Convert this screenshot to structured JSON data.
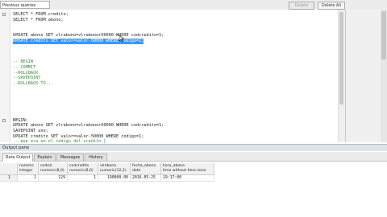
{
  "history": {
    "previous_queries": "Previous queries",
    "delete_label": "Delete",
    "delete_all_label": "Delete All"
  },
  "editor": {
    "lines": [
      {
        "t": "SELECT * FROM credito;"
      },
      {
        "t": "SELECT * FROM abono;"
      },
      {
        "t": ""
      },
      {
        "t": ""
      },
      {
        "t": "UPDATE abono SET vlrabono=vlrabono+50000 WHERE codcredito=1;"
      },
      {
        "t": "UPDATE credito SET valor=valor-50000 WHERE codigo=1;",
        "sel": true
      },
      {
        "t": ""
      },
      {
        "t": ""
      },
      {
        "t": ""
      },
      {
        "t": "-- BEGIN",
        "cm": true
      },
      {
        "t": "-- COMMIT",
        "cm": true
      },
      {
        "t": "--ROLLBACK",
        "cm": true
      },
      {
        "t": "--SAVEPOINT",
        "cm": true
      },
      {
        "t": "--ROLLBACK TO...",
        "cm": true
      },
      {
        "t": ""
      },
      {
        "t": ""
      },
      {
        "t": ""
      },
      {
        "t": ""
      },
      {
        "t": ""
      },
      {
        "t": ""
      },
      {
        "t": "BEGIN;"
      },
      {
        "t": "UPDATE abono SET vlrabono=vlrabono+50000 WHERE codcredito=1;"
      },
      {
        "t": "SAVEPOINT uno;"
      },
      {
        "t": "UPDATE credito SET valor=valor-50000 WHERE codigo=1;"
      },
      {
        "t": "-- que era en el codigo del credito }",
        "cm": true
      }
    ]
  },
  "output": {
    "title": "Output pane",
    "tabs": [
      "Data Output",
      "Explain",
      "Messages",
      "History"
    ],
    "columns": [
      {
        "name": "numero",
        "type": "integer"
      },
      {
        "name": "codick",
        "type": "numeric(8,0)"
      },
      {
        "name": "codcredito",
        "type": "numeric(8,0)"
      },
      {
        "name": "vlrabono",
        "type": "numeric(12,2)"
      },
      {
        "name": "fecha_abono",
        "type": "date"
      },
      {
        "name": "hora_abono",
        "type": "time without time zone"
      }
    ],
    "rows": [
      {
        "rownum": "1",
        "cells": [
          "1",
          "129",
          "1",
          "190000.00",
          "2016-05-25",
          "19:17:00"
        ]
      }
    ]
  }
}
